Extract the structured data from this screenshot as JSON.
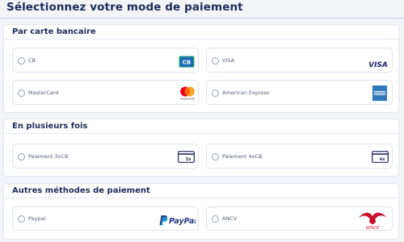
{
  "title": "Sélectionnez votre mode de paiement",
  "sections": [
    {
      "title": "Par carte bancaire",
      "options": [
        {
          "label": "CB",
          "icon": "cb-card-icon"
        },
        {
          "label": "VISA",
          "icon": "visa-logo-icon",
          "logo_text": "VISA"
        },
        {
          "label": "MasterCard",
          "icon": "mastercard-logo-icon",
          "logo_text": "mastercard"
        },
        {
          "label": "American Express",
          "icon": "american-express-logo-icon"
        }
      ]
    },
    {
      "title": "En plusieurs fois",
      "options": [
        {
          "label": "Paiement 3xCB",
          "icon": "card-3x-icon",
          "logo_text": "3x"
        },
        {
          "label": "Paiement 4xCB",
          "icon": "card-4x-icon",
          "logo_text": "4x"
        }
      ]
    },
    {
      "title": "Autres méthodes de paiement",
      "options": [
        {
          "label": "Paypal",
          "icon": "paypal-logo-icon",
          "logo_text": "PayPal"
        },
        {
          "label": "ANCV",
          "icon": "ancv-logo-icon",
          "logo_text": "ancv"
        }
      ]
    }
  ],
  "colors": {
    "navy": "#1f2a5a",
    "cb_green": "#1f9d73",
    "cb_blue": "#1b6ab5",
    "visa_blue": "#1a1f71",
    "amex_blue": "#2e77bb",
    "paypal_dark": "#253b80",
    "paypal_light": "#179bd7",
    "ancv_red": "#c8102e"
  }
}
